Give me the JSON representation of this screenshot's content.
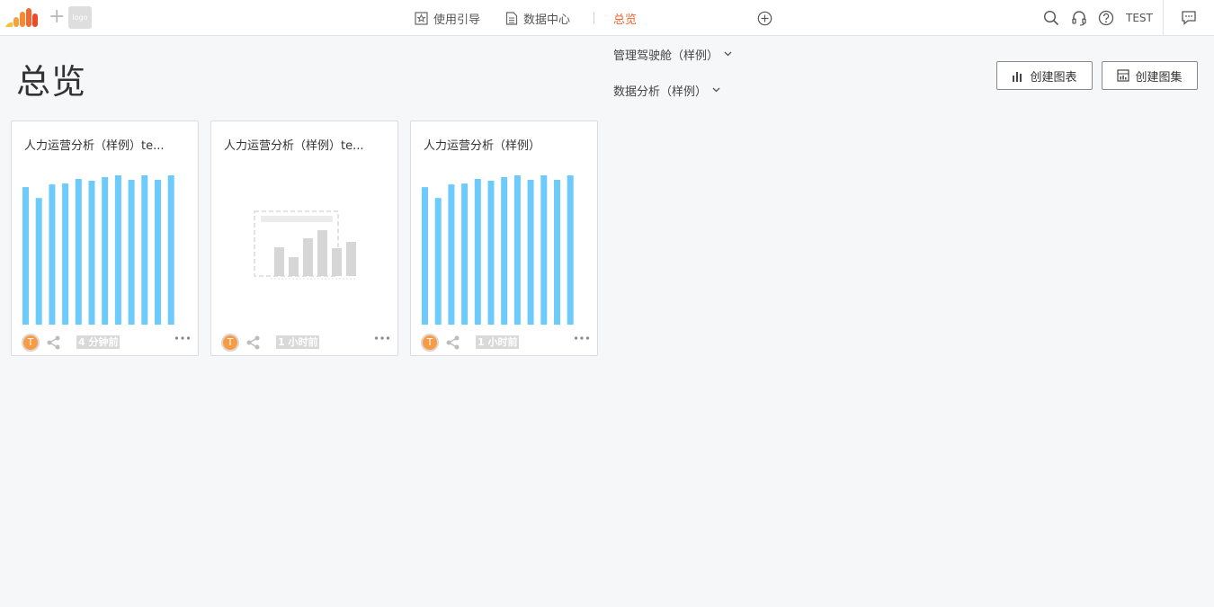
{
  "topbar": {
    "logo_text": "logo",
    "nav": {
      "guide_label": "使用引导",
      "data_center_label": "数据中心",
      "overview_label": "总览"
    },
    "user_name": "TEST"
  },
  "dropdowns": [
    {
      "label": "管理驾驶舱（样例）"
    },
    {
      "label": "数据分析（样例）"
    }
  ],
  "page": {
    "title": "总览"
  },
  "actions": {
    "create_chart_label": "创建图表",
    "create_dashboard_label": "创建图集"
  },
  "colors": {
    "accent": "#f0642a",
    "bar": "#6ccbfa",
    "placeholder": "#d6d6d6",
    "avatar": "#f79b47"
  },
  "cards": [
    {
      "title": "人力运营分析（样例）te...",
      "avatar_letter": "T",
      "time": "4 分钟前",
      "chart": "bar",
      "values": [
        152,
        140,
        155,
        156,
        161,
        159,
        163,
        165,
        160,
        165,
        160,
        165
      ]
    },
    {
      "title": "人力运营分析（样例）te...",
      "avatar_letter": "T",
      "time": "1 小时前",
      "chart": "placeholder"
    },
    {
      "title": "人力运营分析（样例）",
      "avatar_letter": "T",
      "time": "1 小时前",
      "chart": "bar",
      "values": [
        152,
        140,
        155,
        156,
        161,
        159,
        163,
        165,
        160,
        165,
        160,
        165
      ]
    }
  ]
}
